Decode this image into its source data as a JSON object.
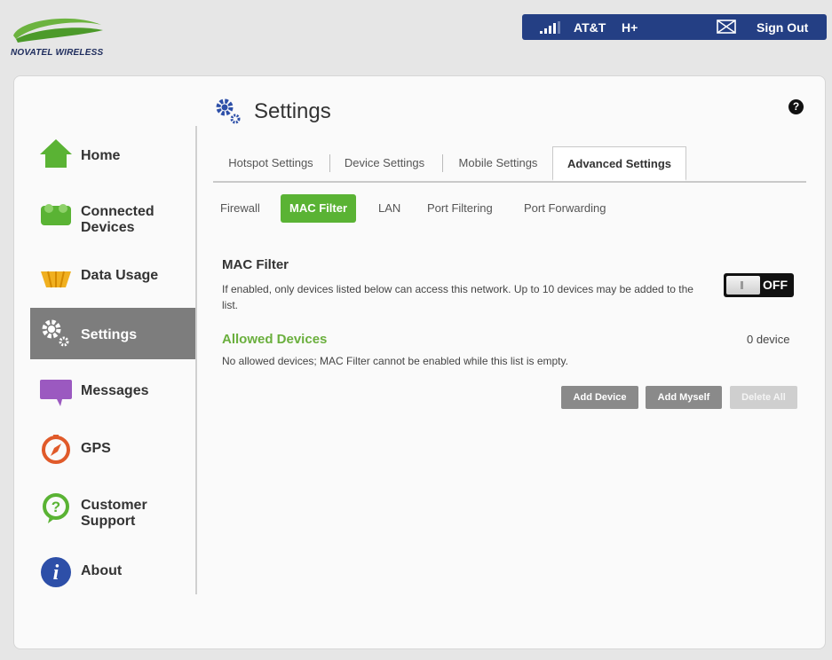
{
  "brand": {
    "logo_text": "NOVATEL WIRELESS",
    "logo_color": "#6cb33f"
  },
  "topbar": {
    "carrier": "AT&T",
    "network_type": "H+",
    "sign_out": "Sign Out",
    "bg_color": "#243f84"
  },
  "sidebar": {
    "items": [
      {
        "label": "Home",
        "icon": "home-icon"
      },
      {
        "label": "Connected Devices",
        "icon": "connected-devices-icon"
      },
      {
        "label": "Data Usage",
        "icon": "data-usage-icon"
      },
      {
        "label": "Settings",
        "icon": "settings-gear-icon",
        "active": true
      },
      {
        "label": "Messages",
        "icon": "messages-icon"
      },
      {
        "label": "GPS",
        "icon": "gps-compass-icon"
      },
      {
        "label": "Customer Support",
        "icon": "customer-support-icon"
      },
      {
        "label": "About",
        "icon": "about-info-icon"
      }
    ]
  },
  "page": {
    "title": "Settings",
    "help": "?"
  },
  "tabs": [
    "Hotspot Settings",
    "Device Settings",
    "Mobile Settings",
    "Advanced Settings"
  ],
  "active_tab": "Advanced Settings",
  "subtabs": [
    "Firewall",
    "MAC Filter",
    "LAN",
    "Port Filtering",
    "Port Forwarding"
  ],
  "active_subtab": "MAC Filter",
  "mac_filter": {
    "title": "MAC Filter",
    "description": "If enabled, only devices listed below can access this network. Up to 10 devices may be added to the list.",
    "toggle_state": "OFF"
  },
  "allowed": {
    "title": "Allowed Devices",
    "count": "0  device",
    "empty_message": "No allowed devices; MAC Filter cannot be enabled while this list is empty."
  },
  "buttons": {
    "add_device": "Add Device",
    "add_myself": "Add Myself",
    "delete_all": "Delete All"
  },
  "accent_color": "#5ab334"
}
